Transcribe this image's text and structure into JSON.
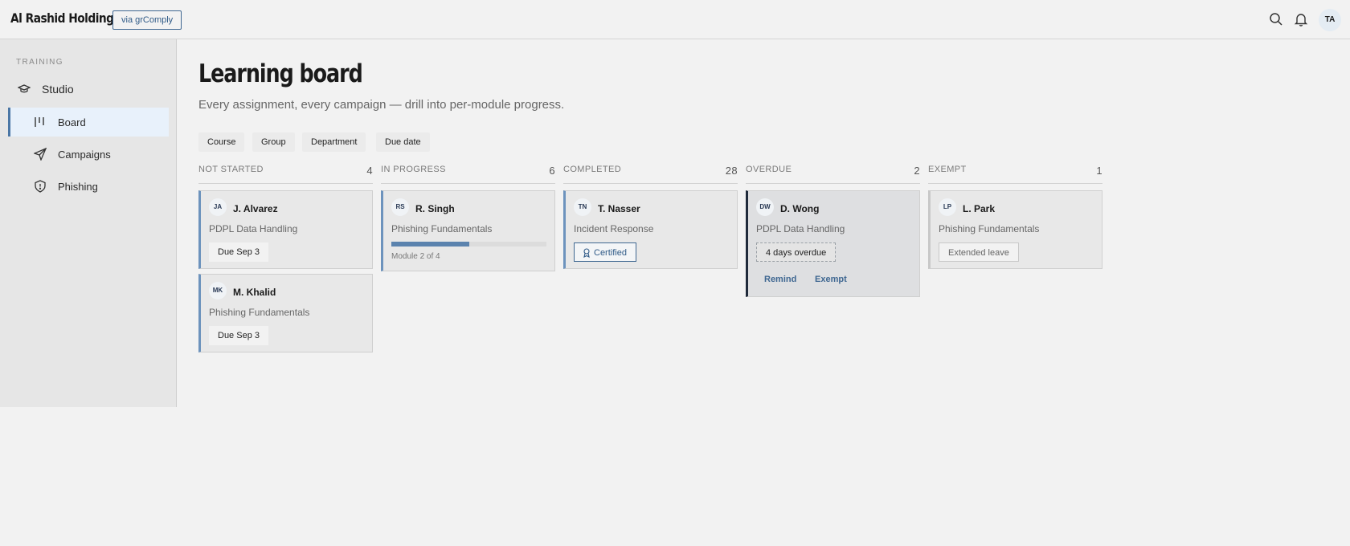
{
  "app": {
    "brand": "Al Rashid Holdings",
    "via_label": "via grComply",
    "user_initials": "TA"
  },
  "sidebar": {
    "section": "TRAINING",
    "items": [
      {
        "label": "Studio",
        "icon": "graduation-cap-icon"
      },
      {
        "label": "Board",
        "icon": "board-columns-icon",
        "active": true
      },
      {
        "label": "Campaigns",
        "icon": "paper-plane-icon"
      },
      {
        "label": "Phishing",
        "icon": "shield-icon"
      }
    ]
  },
  "page": {
    "title": "Learning board",
    "subtitle": "Every assignment, every campaign — drill into per-module progress."
  },
  "filters": [
    "Course",
    "Group",
    "Department",
    "Due date"
  ],
  "columns": [
    {
      "title": "NOT STARTED",
      "count": "4",
      "cards": [
        {
          "initials": "JA",
          "name": "J. Alvarez",
          "course": "PDPL Data Handling",
          "tag": "Due Sep 3"
        },
        {
          "initials": "MK",
          "name": "M. Khalid",
          "course": "Phishing Fundamentals",
          "tag": "Due Sep 3"
        }
      ]
    },
    {
      "title": "IN PROGRESS",
      "count": "6",
      "cards": [
        {
          "initials": "RS",
          "name": "R. Singh",
          "course": "Phishing Fundamentals",
          "progress_fraction": 0.5,
          "module": "Module 2 of 4"
        }
      ]
    },
    {
      "title": "COMPLETED",
      "count": "28",
      "cards": [
        {
          "initials": "TN",
          "name": "T. Nasser",
          "course": "Incident Response",
          "tag": "Certified"
        }
      ]
    },
    {
      "title": "OVERDUE",
      "count": "2",
      "cards": [
        {
          "initials": "DW",
          "name": "D. Wong",
          "course": "PDPL Data Handling",
          "tag": "4 days overdue",
          "actions": [
            "Remind",
            "Exempt"
          ]
        }
      ]
    },
    {
      "title": "EXEMPT",
      "count": "1",
      "cards": [
        {
          "initials": "LP",
          "name": "L. Park",
          "course": "Phishing Fundamentals",
          "tag": "Extended leave"
        }
      ]
    }
  ],
  "colors": {
    "accent": "#4a76a5",
    "overdue_border": "#1f2a3a",
    "exempt_border": "#c8c8c8"
  }
}
